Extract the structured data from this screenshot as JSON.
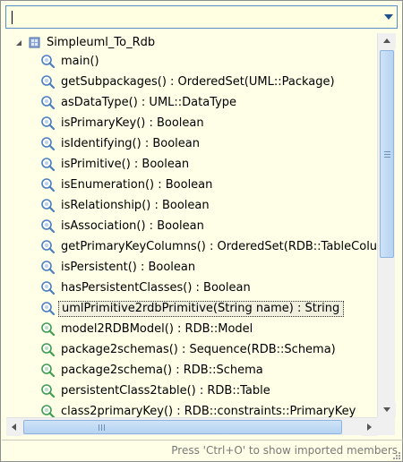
{
  "filter": {
    "value": ""
  },
  "tree": {
    "root": {
      "label": "Simpleuml_To_Rdb",
      "expanded": true
    },
    "items": [
      {
        "label": "main()",
        "kind": "query",
        "selected": false
      },
      {
        "label": "getSubpackages() : OrderedSet(UML::Package)",
        "kind": "query",
        "selected": false
      },
      {
        "label": "asDataType() : UML::DataType",
        "kind": "query",
        "selected": false
      },
      {
        "label": "isPrimaryKey() : Boolean",
        "kind": "query",
        "selected": false
      },
      {
        "label": "isIdentifying() : Boolean",
        "kind": "query",
        "selected": false
      },
      {
        "label": "isPrimitive() : Boolean",
        "kind": "query",
        "selected": false
      },
      {
        "label": "isEnumeration() : Boolean",
        "kind": "query",
        "selected": false
      },
      {
        "label": "isRelationship() : Boolean",
        "kind": "query",
        "selected": false
      },
      {
        "label": "isAssociation() : Boolean",
        "kind": "query",
        "selected": false
      },
      {
        "label": "getPrimaryKeyColumns() : OrderedSet(RDB::TableColu",
        "kind": "query",
        "selected": false
      },
      {
        "label": "isPersistent() : Boolean",
        "kind": "query",
        "selected": false
      },
      {
        "label": "hasPersistentClasses() : Boolean",
        "kind": "query",
        "selected": false
      },
      {
        "label": "umlPrimitive2rdbPrimitive(String name) : String",
        "kind": "query",
        "selected": true
      },
      {
        "label": "model2RDBModel() : RDB::Model",
        "kind": "mapping",
        "selected": false
      },
      {
        "label": "package2schemas() : Sequence(RDB::Schema)",
        "kind": "mapping",
        "selected": false
      },
      {
        "label": "package2schema() : RDB::Schema",
        "kind": "mapping",
        "selected": false
      },
      {
        "label": "persistentClass2table() : RDB::Table",
        "kind": "mapping",
        "selected": false
      },
      {
        "label": "class2primaryKey() : RDB::constraints::PrimaryKey",
        "kind": "mapping",
        "selected": false
      }
    ]
  },
  "status": {
    "hint": "Press 'Ctrl+O' to show imported members"
  },
  "colors": {
    "background": "#fffee6",
    "selection_border": "#333333",
    "query_icon": "#4a7fc1",
    "mapping_icon": "#3f9e53"
  },
  "icons": {
    "query": "query-operation-icon",
    "mapping": "mapping-operation-icon",
    "root": "module-icon"
  }
}
